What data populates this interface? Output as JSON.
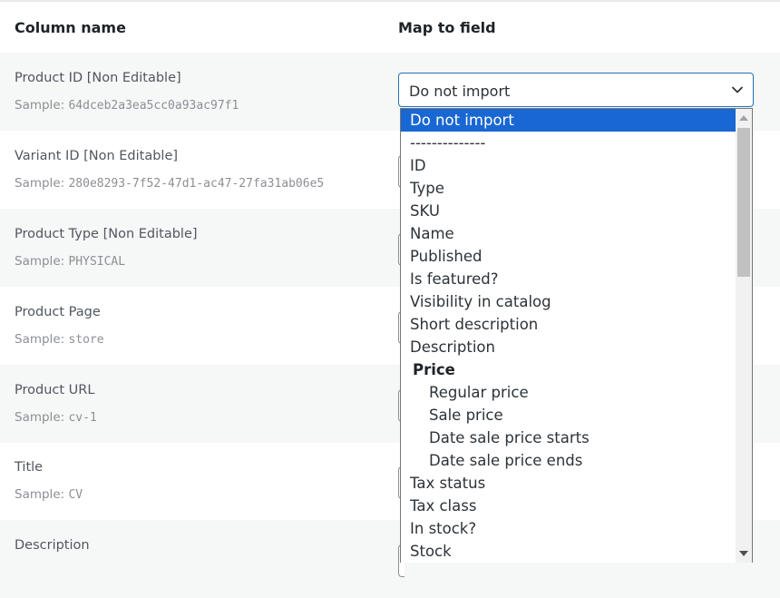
{
  "header": {
    "col_name": "Column name",
    "col_map": "Map to field"
  },
  "rows": [
    {
      "name": "Product ID [Non Editable]",
      "sample_label": "Sample:",
      "sample_value": "64dceb2a3ea5cc0a93ac97f1"
    },
    {
      "name": "Variant ID [Non Editable]",
      "sample_label": "Sample:",
      "sample_value": "280e8293-7f52-47d1-ac47-27fa31ab06e5"
    },
    {
      "name": "Product Type [Non Editable]",
      "sample_label": "Sample:",
      "sample_value": "PHYSICAL"
    },
    {
      "name": "Product Page",
      "sample_label": "Sample:",
      "sample_value": "store"
    },
    {
      "name": "Product URL",
      "sample_label": "Sample:",
      "sample_value": "cv-1"
    },
    {
      "name": "Title",
      "sample_label": "Sample:",
      "sample_value": "CV"
    },
    {
      "name": "Description"
    }
  ],
  "select": {
    "value": "Do not import",
    "icon": "chevron-down-icon"
  },
  "dropdown": {
    "options": [
      {
        "label": "Do not import",
        "kind": "selected"
      },
      {
        "label": "--------------",
        "kind": "normal"
      },
      {
        "label": "ID",
        "kind": "normal"
      },
      {
        "label": "Type",
        "kind": "normal"
      },
      {
        "label": "SKU",
        "kind": "normal"
      },
      {
        "label": "Name",
        "kind": "normal"
      },
      {
        "label": "Published",
        "kind": "normal"
      },
      {
        "label": "Is featured?",
        "kind": "normal"
      },
      {
        "label": "Visibility in catalog",
        "kind": "normal"
      },
      {
        "label": "Short description",
        "kind": "normal"
      },
      {
        "label": "Description",
        "kind": "normal"
      },
      {
        "label": "Price",
        "kind": "group"
      },
      {
        "label": "Regular price",
        "kind": "indent"
      },
      {
        "label": "Sale price",
        "kind": "indent"
      },
      {
        "label": "Date sale price starts",
        "kind": "indent"
      },
      {
        "label": "Date sale price ends",
        "kind": "indent"
      },
      {
        "label": "Tax status",
        "kind": "normal"
      },
      {
        "label": "Tax class",
        "kind": "normal"
      },
      {
        "label": "In stock?",
        "kind": "normal"
      },
      {
        "label": "Stock",
        "kind": "normal"
      }
    ]
  },
  "colors": {
    "accent": "#2271b1",
    "selected_option": "#1967d2",
    "alt_row": "#f6f7f7"
  }
}
